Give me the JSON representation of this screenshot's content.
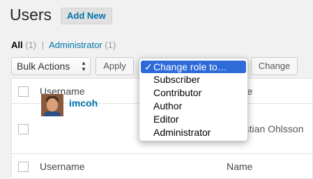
{
  "header": {
    "title": "Users",
    "add_new": "Add New"
  },
  "filters": {
    "all_label": "All",
    "all_count": "(1)",
    "separator": "|",
    "admin_label": "Administrator",
    "admin_count": "(1)"
  },
  "toolbar": {
    "bulk_actions": "Bulk Actions",
    "apply": "Apply",
    "change": "Change"
  },
  "role_dropdown": {
    "check": "✓",
    "options": [
      "Change role to…",
      "Subscriber",
      "Contributor",
      "Author",
      "Editor",
      "Administrator"
    ],
    "selected": "Change role to…"
  },
  "table": {
    "columns": {
      "username": "Username",
      "name": "Name"
    },
    "name_partial": "Name",
    "rows": [
      {
        "username": "imcoh",
        "name": "Christian Ohlsson"
      }
    ]
  }
}
